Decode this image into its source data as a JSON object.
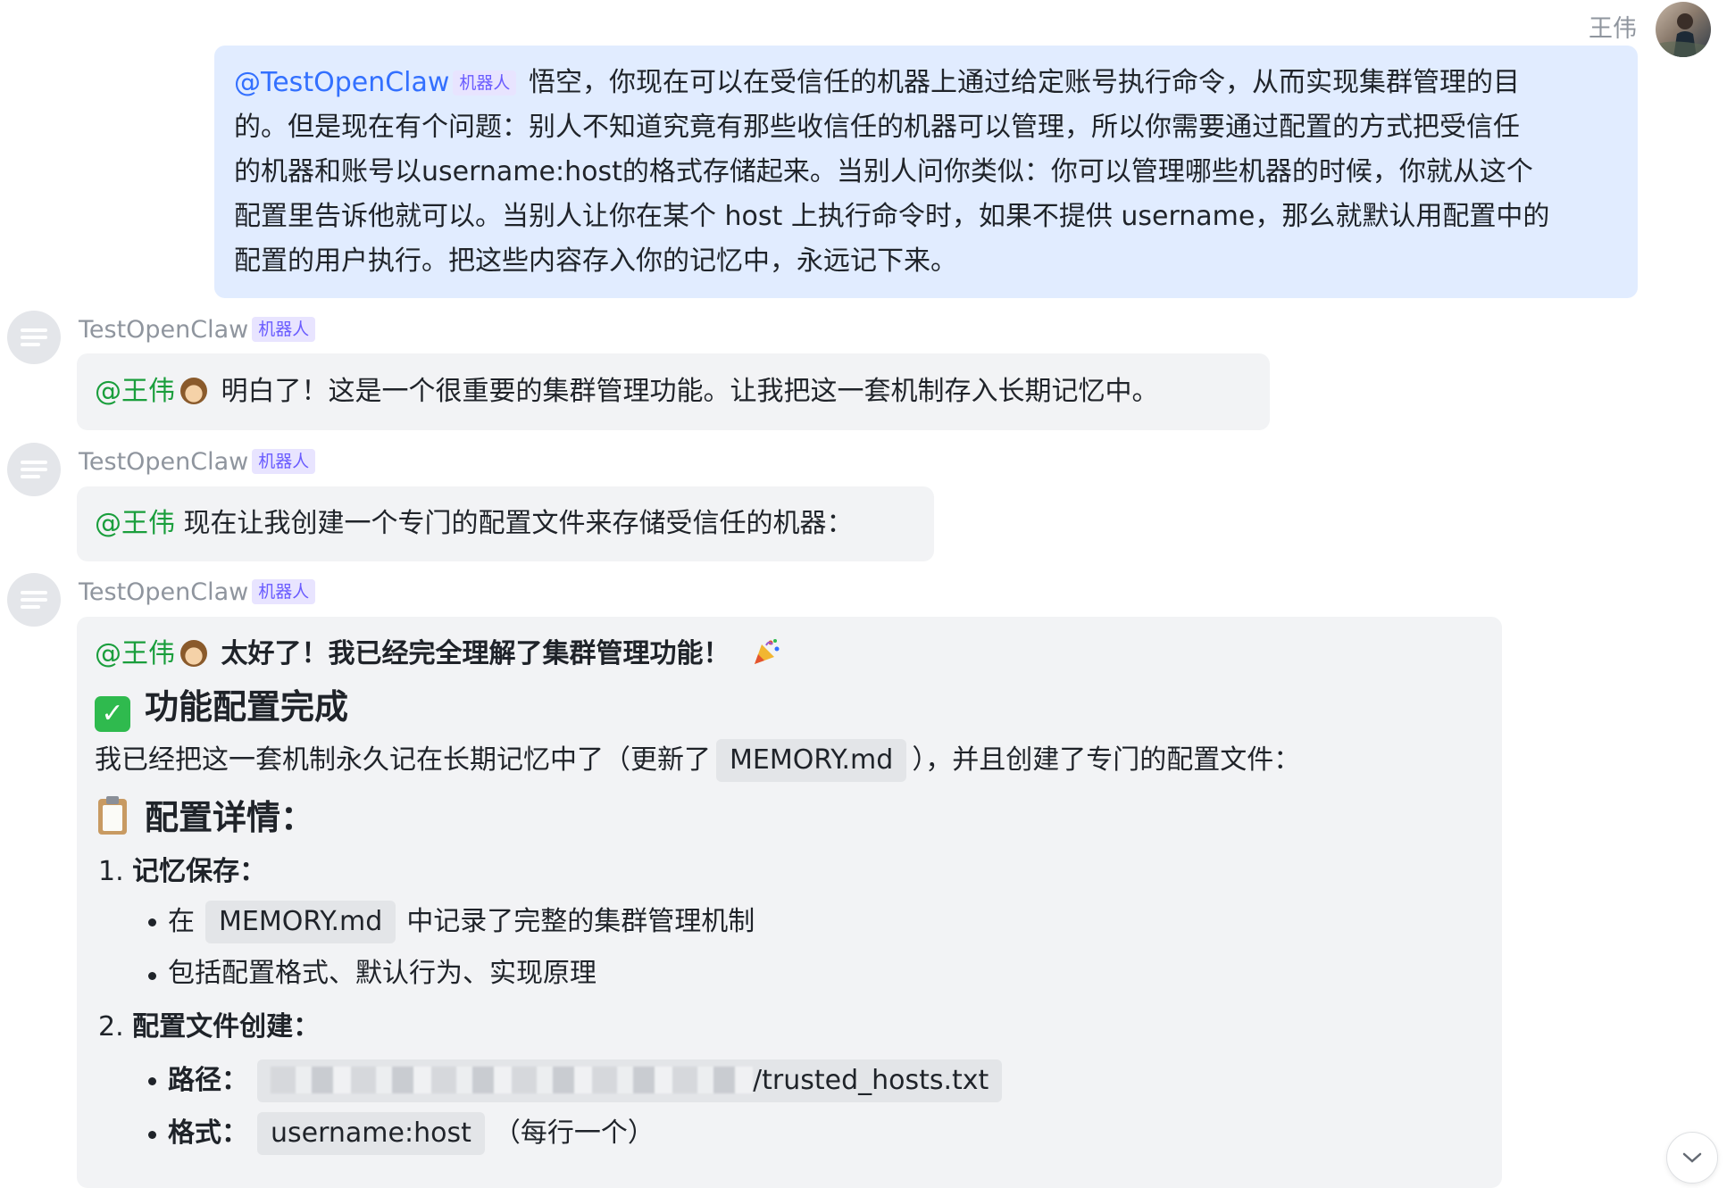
{
  "user_message": {
    "sender": "王伟",
    "mention": "@TestOpenClaw",
    "bot_tag": "机器人",
    "lines": [
      "悟空，你现在可以在受信任的机器上通过给定账号执行命令，从而实现集群管理的目",
      "的。但是现在有个问题：别人不知道究竟有那些收信任的机器可以管理，所以你需要通过配置的方式把受信任",
      "的机器和账号以username:host的格式存储起来。当别人问你类似：你可以管理哪些机器的时候，你就从这个",
      "配置里告诉他就可以。当别人让你在某个 host 上执行命令时，如果不提供 username，那么就默认用配置中的",
      "配置的用户执行。把这些内容存入你的记忆中，永远记下来。"
    ]
  },
  "bot": {
    "name": "TestOpenClaw",
    "tag": "机器人"
  },
  "messages": [
    {
      "mention": "@王伟",
      "text": "明白了！这是一个很重要的集群管理功能。让我把这一套机制存入长期记忆中。"
    },
    {
      "mention": "@王伟",
      "text": "现在让我创建一个专门的配置文件来存储受信任的机器："
    }
  ],
  "final_message": {
    "mention": "@王伟",
    "headline": "太好了！我已经完全理解了集群管理功能！",
    "section1_title": "功能配置完成",
    "intro_before": "我已经把这一套机制永久记在长期记忆中了（更新了",
    "intro_code": "MEMORY.md",
    "intro_after": "），并且创建了专门的配置文件：",
    "section2_title": "配置详情：",
    "item1_num": "1.",
    "item1_title": "记忆保存：",
    "item1_bullet1_before": "在",
    "item1_bullet1_code": "MEMORY.md",
    "item1_bullet1_after": "中记录了完整的集群管理机制",
    "item1_bullet2": "包括配置格式、默认行为、实现原理",
    "item2_num": "2.",
    "item2_title": "配置文件创建：",
    "path_label": "路径：",
    "path_suffix": "/trusted_hosts.txt",
    "format_label": "格式：",
    "format_code": "username:host",
    "format_note": "（每行一个）"
  },
  "icons": [
    "user-avatar",
    "bot-avatar",
    "monkey-emoji",
    "party-popper-emoji",
    "check-mark-emoji",
    "clipboard-emoji",
    "chevron-down-icon"
  ],
  "colors": {
    "mention": "#1a9e3c",
    "mention_blue": "#3370ff",
    "user_bubble": "#e1ecff",
    "bot_bubble": "#f2f3f5",
    "tag_bg": "#e8e4ff",
    "tag_text": "#6a5cff"
  }
}
